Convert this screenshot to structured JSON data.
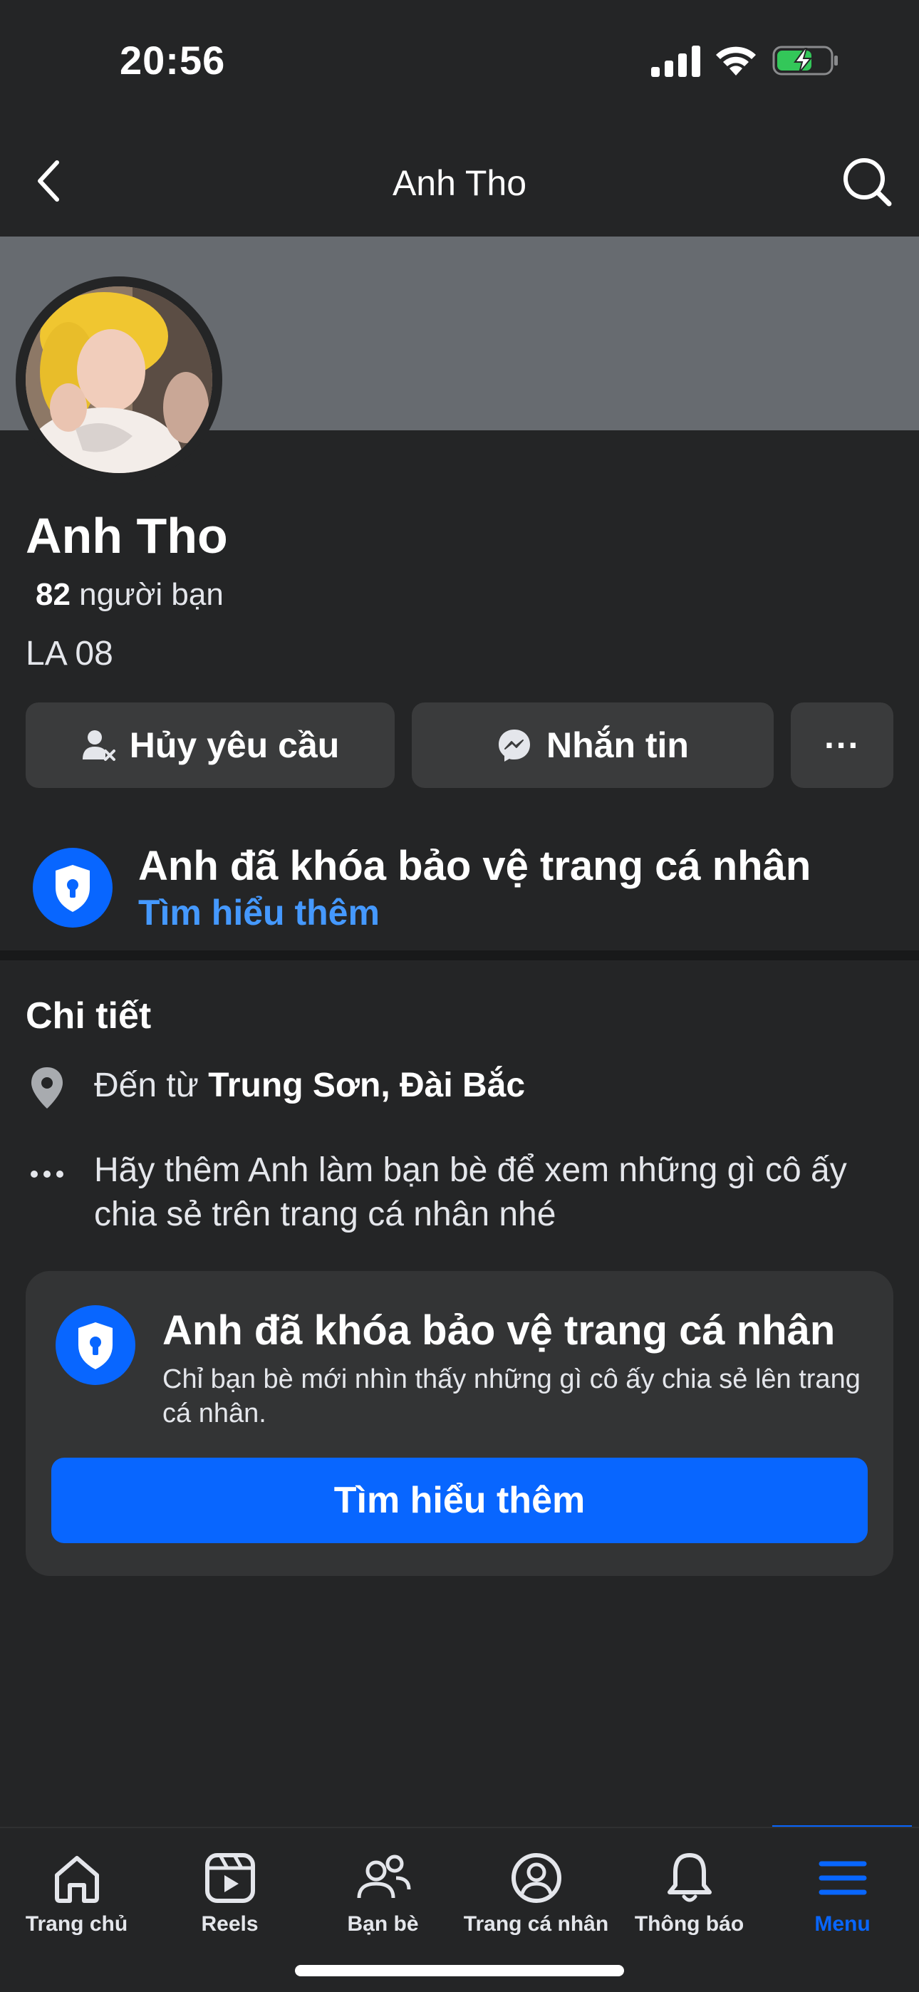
{
  "status_bar": {
    "time": "20:56",
    "battery_charging": true
  },
  "header": {
    "title": "Anh Tho"
  },
  "profile": {
    "name": "Anh Tho",
    "friend_count": "82",
    "friends_label": " người bạn",
    "bio": "LA 08"
  },
  "actions": {
    "cancel_request": "Hủy yêu cầu",
    "message": "Nhắn tin",
    "more": "···"
  },
  "lock_banner": {
    "title": "Anh đã khóa bảo vệ trang cá nhân",
    "link": "Tìm hiểu thêm"
  },
  "details": {
    "heading": "Chi tiết",
    "from_prefix": "Đến từ ",
    "from_place": "Trung Sơn, Đài Bắc",
    "hint": "Hãy thêm Anh làm bạn bè để xem những gì cô ấy chia sẻ trên trang cá nhân nhé"
  },
  "lock_card": {
    "title": "Anh đã khóa bảo vệ trang cá nhân",
    "description": "Chỉ bạn bè mới nhìn thấy những gì cô ấy chia sẻ lên trang cá nhân.",
    "button": "Tìm hiểu thêm"
  },
  "tabs": [
    {
      "label": "Trang chủ",
      "icon": "home-icon",
      "active": false
    },
    {
      "label": "Reels",
      "icon": "reels-icon",
      "active": false
    },
    {
      "label": "Bạn bè",
      "icon": "friends-icon",
      "active": false
    },
    {
      "label": "Trang cá nhân",
      "icon": "profile-icon",
      "active": false
    },
    {
      "label": "Thông báo",
      "icon": "bell-icon",
      "active": false
    },
    {
      "label": "Menu",
      "icon": "menu-icon",
      "active": true
    }
  ],
  "colors": {
    "background": "#242526",
    "accent": "#0866ff",
    "link": "#4599ff",
    "button_bg": "#3a3b3c",
    "cover": "#676b70"
  }
}
